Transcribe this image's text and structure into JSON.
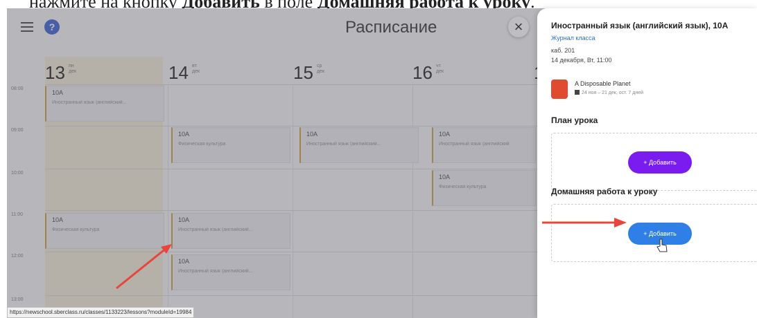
{
  "caption": {
    "before": "нажмите на кнопку ",
    "bold1": "Добавить",
    "middle": " в поле ",
    "bold2": "Домашняя работа к уроку",
    "after": "."
  },
  "header": {
    "title": "Расписание",
    "help": "?",
    "close": "×"
  },
  "days": [
    {
      "num": "13",
      "wd1": "пн",
      "wd2": "дек"
    },
    {
      "num": "14",
      "wd1": "вт",
      "wd2": "дек"
    },
    {
      "num": "15",
      "wd1": "ср",
      "wd2": "дек"
    },
    {
      "num": "16",
      "wd1": "чт",
      "wd2": "дек"
    },
    {
      "num": "1"
    }
  ],
  "times": [
    "08:00",
    "09:00",
    "10:00",
    "11:00",
    "12:00",
    "13:00"
  ],
  "lessons": [
    {
      "cls": "10А",
      "subj": "Иностранный язык (английский..."
    },
    {
      "cls": "10А",
      "subj": "Физическая культура"
    },
    {
      "cls": "10А",
      "subj": "Иностранный язык (английский..."
    },
    {
      "cls": "10А",
      "subj": "Иностранный язык (английский"
    },
    {
      "cls": "10А",
      "subj": "Физическая культура"
    },
    {
      "cls": "10А",
      "subj": "Физическая культура"
    },
    {
      "cls": "10А",
      "subj": "Иностранный язык (английский..."
    },
    {
      "cls": "10А",
      "subj": "Иностранный язык (английский..."
    }
  ],
  "status_url": "https://newschool.sberclass.ru/classes/1133223/lessons?moduleId=19984",
  "panel": {
    "title": "Иностранный язык (английский язык), 10А",
    "journal_link": "Журнал класса",
    "room": "каб. 201",
    "datetime": "14 декабря, Вт, 11:00",
    "course_name": "A Disposable Planet",
    "course_dates": "24 ноя – 21 дек, ост. 7 дней",
    "plan_heading": "План урока",
    "plan_add": "+ Добавить",
    "hw_heading": "Домашняя работа к уроку",
    "hw_add": "+ Добавить"
  },
  "colors": {
    "accent_purple": "#7a1cf0",
    "accent_blue": "#2f7fe6",
    "arrow": "#e8453c",
    "today": "#f1ead8"
  },
  "icons": [
    "menu-icon",
    "help-icon",
    "close-icon",
    "calendar-icon",
    "hand-cursor-icon",
    "arrow-annotation"
  ]
}
